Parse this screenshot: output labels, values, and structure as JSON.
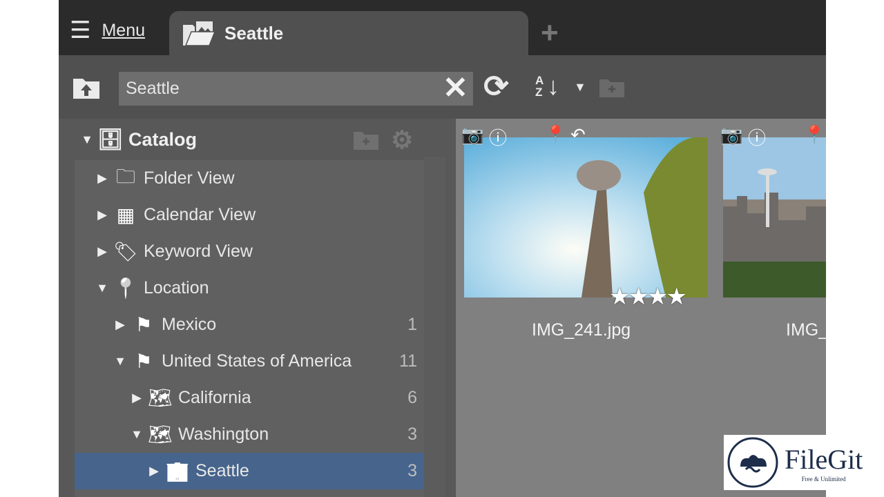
{
  "tabbar": {
    "menu_label": "Menu",
    "active_tab": "Seattle",
    "add_tab_icon": "plus-icon"
  },
  "toolbar": {
    "search_value": "Seattle",
    "clear_icon": "close-icon",
    "refresh_icon": "refresh-icon",
    "sort_icon": "sort-az-icon",
    "up_icon": "folder-up-icon",
    "new_folder_icon": "folder-add-icon"
  },
  "sidebar": {
    "catalog_label": "Catalog",
    "items": [
      {
        "label": "Folder View",
        "icon": "folder-icon",
        "count": ""
      },
      {
        "label": "Calendar View",
        "icon": "calendar-icon",
        "count": ""
      },
      {
        "label": "Keyword View",
        "icon": "tag-icon",
        "count": ""
      },
      {
        "label": "Location",
        "icon": "map-pin-icon",
        "count": ""
      },
      {
        "label": "Mexico",
        "icon": "flag-icon",
        "count": "1"
      },
      {
        "label": "United States of America",
        "icon": "flag-icon",
        "count": "11"
      },
      {
        "label": "California",
        "icon": "map-icon",
        "count": "6"
      },
      {
        "label": "Washington",
        "icon": "map-icon",
        "count": "3"
      },
      {
        "label": "Seattle",
        "icon": "city-icon",
        "count": "3",
        "selected": true
      }
    ]
  },
  "content": {
    "thumbnails": [
      {
        "filename": "IMG_241.jpg",
        "rating": 4
      },
      {
        "filename": "IMG_"
      }
    ]
  },
  "watermark": {
    "brand": "FileGit",
    "tagline": "Free & Unlimited"
  },
  "colors": {
    "selection": "#46648c",
    "tabbar": "#2b2b2b",
    "panel": "#505050"
  }
}
